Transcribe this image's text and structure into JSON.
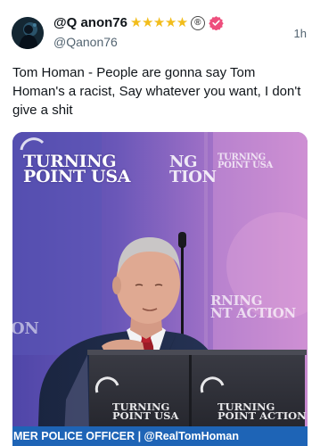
{
  "post": {
    "display_name": "@Q anon76",
    "star_count": 5,
    "registered_mark": "®",
    "handle": "@Qanon76",
    "timestamp": "1h",
    "text": "Tom Homan - People are gonna say Tom Homan's a racist, Say whatever you want, I don't give a shit",
    "colors": {
      "star": "#f2bd1b",
      "verified_badge": "#ee4f7d",
      "banner": "#1e64b6"
    }
  },
  "media": {
    "backdrop_sign_left": [
      "TURNING",
      "POINT USA"
    ],
    "backdrop_sign_middle": [
      "NG",
      "TION"
    ],
    "backdrop_sign_right": [
      "TURNING",
      "POINT USA"
    ],
    "backdrop_sign_right_lower": [
      "RNING",
      "NT ACTION"
    ],
    "backdrop_sign_lower_left": "ON",
    "podium_logo_left": [
      "TURNING",
      "POINT USA"
    ],
    "podium_logo_right": [
      "TURNING",
      "POINT ACTION"
    ],
    "caption_banner": "MER POLICE OFFICER | @RealTomHoman"
  },
  "icons": {
    "verified": "verified-badge-icon",
    "avatar": "avatar"
  }
}
